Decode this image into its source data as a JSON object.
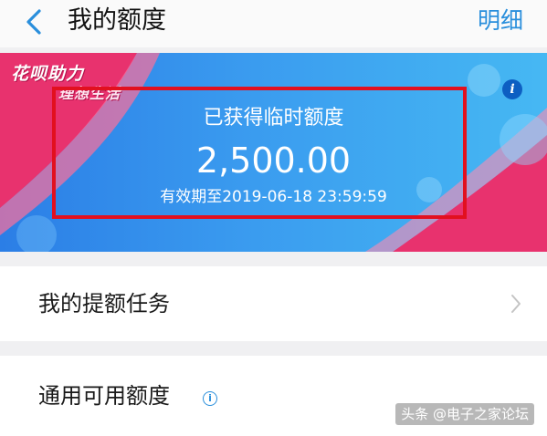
{
  "header": {
    "title": "我的额度",
    "detail_label": "明细"
  },
  "banner": {
    "brand_line1": "花呗助力",
    "brand_line2": "理想生活",
    "credit_label": "已获得临时额度",
    "credit_amount": "2,500.00",
    "validity": "有效期至2019-06-18 23:59:59"
  },
  "list": {
    "tasks_label": "我的提额任务",
    "general_label": "通用可用额度"
  },
  "watermark": "头条 @电子之家论坛",
  "colors": {
    "accent": "#2a8fdc",
    "banner_blue": "#3a9bef",
    "banner_pink": "#e8326e",
    "highlight_red": "#e2101f"
  },
  "icons": [
    "back-arrow-icon",
    "info-icon",
    "chevron-right-icon",
    "circle-info-icon"
  ]
}
